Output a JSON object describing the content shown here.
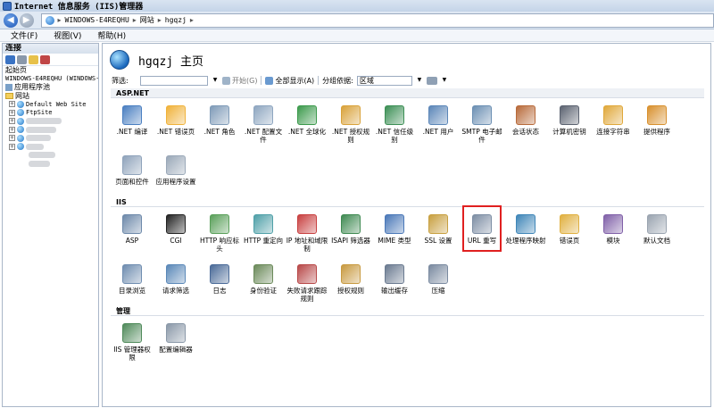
{
  "window": {
    "title": "Internet 信息服务 (IIS)管理器"
  },
  "address": {
    "segments": [
      "WINDOWS-E4REQHU",
      "网站",
      "hgqzj"
    ]
  },
  "menu": [
    "文件(F)",
    "视图(V)",
    "帮助(H)"
  ],
  "connections": {
    "header": "连接",
    "tree": [
      {
        "label": "起始页",
        "icon": "start-page-icon",
        "indent": 0,
        "expander": ""
      },
      {
        "label": "WINDOWS-E4REQHU (WINDOWS-E",
        "icon": "server-icon",
        "indent": 0,
        "expander": ""
      },
      {
        "label": "应用程序池",
        "icon": "app-pool-icon",
        "indent": 1,
        "expander": ""
      },
      {
        "label": "网站",
        "icon": "sites-folder-icon",
        "indent": 1,
        "expander": ""
      },
      {
        "label": "Default Web Site",
        "icon": "globe-icon",
        "indent": 2,
        "expander": "+"
      },
      {
        "label": "FtpSite",
        "icon": "globe-icon",
        "indent": 2,
        "expander": "+"
      }
    ]
  },
  "main": {
    "title": "hgqzj 主页",
    "filter_label": "筛选:",
    "start_label": "开始(G)",
    "show_all_label": "全部显示(A)",
    "group_by_label": "分组依据:",
    "group_by_value": "区域",
    "sections": [
      {
        "name": "ASP.NET",
        "items": [
          {
            "label": ".NET 编译",
            "icon": "net-compile-icon",
            "color": "#4a7fc1"
          },
          {
            "label": ".NET 错误页",
            "icon": "net-error-page-icon",
            "color": "#f0b23a"
          },
          {
            "label": ".NET 角色",
            "icon": "net-roles-icon",
            "color": "#7f9bb8"
          },
          {
            "label": ".NET 配置文件",
            "icon": "net-profile-icon",
            "color": "#8ea6c0"
          },
          {
            "label": ".NET 全球化",
            "icon": "net-globalization-icon",
            "color": "#3c9a4c"
          },
          {
            "label": ".NET 授权规则",
            "icon": "net-authorization-icon",
            "color": "#d9a23a"
          },
          {
            "label": ".NET 信任级别",
            "icon": "net-trust-level-icon",
            "color": "#3c8f55"
          },
          {
            "label": ".NET 用户",
            "icon": "net-users-icon",
            "color": "#5b86b8"
          },
          {
            "label": "SMTP 电子邮件",
            "icon": "smtp-email-icon",
            "color": "#6b8fb3"
          },
          {
            "label": "会话状态",
            "icon": "session-state-icon",
            "color": "#b86a3a"
          },
          {
            "label": "计算机密钥",
            "icon": "machine-key-icon",
            "color": "#5b6270"
          },
          {
            "label": "连接字符串",
            "icon": "connection-strings-icon",
            "color": "#e0a83a"
          },
          {
            "label": "提供程序",
            "icon": "providers-icon",
            "color": "#d8902e"
          },
          {
            "label": "页面和控件",
            "icon": "pages-controls-icon",
            "color": "#8fa3bb"
          },
          {
            "label": "应用程序设置",
            "icon": "app-settings-icon",
            "color": "#9aa8b8"
          }
        ]
      },
      {
        "name": "IIS",
        "items": [
          {
            "label": "ASP",
            "icon": "asp-icon",
            "color": "#6d89aa"
          },
          {
            "label": "CGI",
            "icon": "cgi-icon",
            "color": "#222222"
          },
          {
            "label": "HTTP 响应标头",
            "icon": "http-headers-icon",
            "color": "#5aa05a"
          },
          {
            "label": "HTTP 重定向",
            "icon": "http-redirect-icon",
            "color": "#4fa0a8"
          },
          {
            "label": "IP 地址和域限制",
            "icon": "ip-restrictions-icon",
            "color": "#c84040"
          },
          {
            "label": "ISAPI 筛选器",
            "icon": "isapi-filters-icon",
            "color": "#3f8a52"
          },
          {
            "label": "MIME 类型",
            "icon": "mime-types-icon",
            "color": "#4a78b8"
          },
          {
            "label": "SSL 设置",
            "icon": "ssl-settings-icon",
            "color": "#c8a040"
          },
          {
            "label": "URL 重写",
            "icon": "url-rewrite-icon",
            "color": "#7d8ea4"
          },
          {
            "label": "处理程序映射",
            "icon": "handler-mappings-icon",
            "color": "#3f86b8"
          },
          {
            "label": "错误页",
            "icon": "error-pages-icon",
            "color": "#e0b040"
          },
          {
            "label": "模块",
            "icon": "modules-icon",
            "color": "#8060a8"
          },
          {
            "label": "默认文档",
            "icon": "default-document-icon",
            "color": "#9aa4b0"
          },
          {
            "label": "目录浏览",
            "icon": "directory-browsing-icon",
            "color": "#6f8db0"
          },
          {
            "label": "请求筛选",
            "icon": "request-filtering-icon",
            "color": "#5a88b8"
          },
          {
            "label": "日志",
            "icon": "logging-icon",
            "color": "#4a6a98"
          },
          {
            "label": "身份验证",
            "icon": "authentication-icon",
            "color": "#6b8a5a"
          },
          {
            "label": "失败请求跟踪规则",
            "icon": "failed-request-tracing-icon",
            "color": "#b84848"
          },
          {
            "label": "授权规则",
            "icon": "authorization-rules-icon",
            "color": "#c89a40"
          },
          {
            "label": "输出缓存",
            "icon": "output-caching-icon",
            "color": "#6a7a90"
          },
          {
            "label": "压缩",
            "icon": "compression-icon",
            "color": "#7a8aa0"
          }
        ]
      },
      {
        "name": "管理",
        "items": [
          {
            "label": "IIS 管理器权限",
            "icon": "iis-manager-permissions-icon",
            "color": "#4f8a5a"
          },
          {
            "label": "配置编辑器",
            "icon": "configuration-editor-icon",
            "color": "#8a98a8"
          }
        ]
      }
    ]
  }
}
